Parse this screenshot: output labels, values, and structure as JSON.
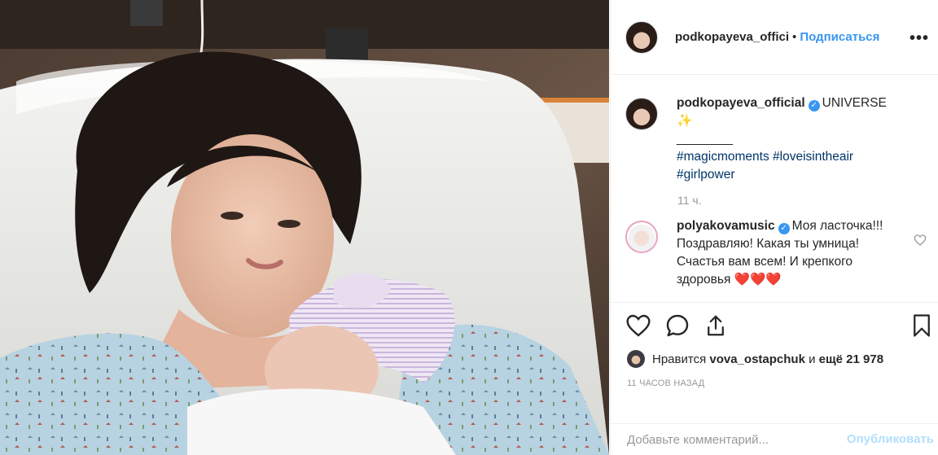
{
  "post": {
    "author": "podkopayeva_official",
    "header_username": "podkopayeva_offici",
    "follow_label": "Подписаться",
    "separator_dot": "•",
    "more_label": "•••",
    "caption": {
      "text_after_badge": "UNIVERSE",
      "emoji": "✨",
      "divider": "________",
      "hashtags_line1": "#magicmoments #loveisintheair",
      "hashtags_line2": "#girlpower"
    },
    "caption_time": "11 ч."
  },
  "comment": {
    "username": "polyakovamusic",
    "text": "Моя ласточка!!! Поздравляю! Какая ты умница! Счастья вам всем! И крепкого здоровья",
    "hearts": "❤️❤️❤️"
  },
  "likes": {
    "prefix": "Нравится",
    "user": "vova_ostapchuk",
    "middle": "и",
    "count": "ещё 21 978"
  },
  "timestamp": "11 ЧАСОВ НАЗАД",
  "add_comment": {
    "placeholder": "Добавьте комментарий...",
    "publish_label": "Опубликовать"
  },
  "icons": {
    "like": "heart-icon",
    "comment": "comment-icon",
    "share": "share-icon",
    "save": "bookmark-icon",
    "verified": "verified-badge-icon",
    "comment_like": "heart-icon"
  },
  "colors": {
    "link_blue": "#3897f0",
    "hashtag": "#003569",
    "muted": "#999999",
    "publish_disabled": "#b2dffc"
  }
}
